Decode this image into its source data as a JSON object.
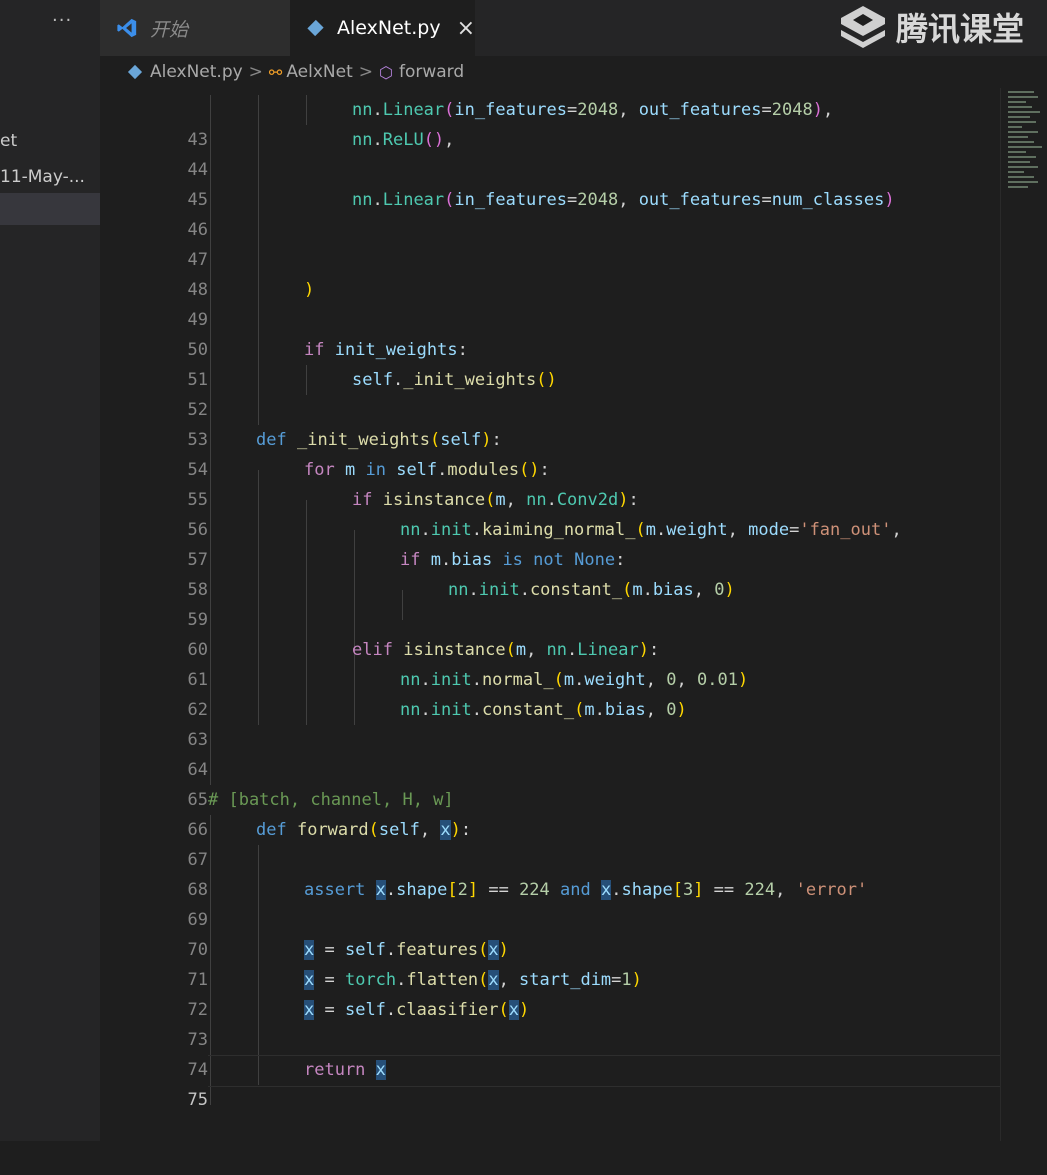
{
  "sidebar": {
    "more_label": "···",
    "items": [
      "et",
      "11-May-..."
    ]
  },
  "tabs": [
    {
      "label": "开始",
      "active": false
    },
    {
      "label": "AlexNet.py",
      "active": true,
      "close": "×"
    }
  ],
  "watermark": {
    "text": "腾讯课堂"
  },
  "breadcrumb": {
    "file": "AlexNet.py",
    "class": "AelxNet",
    "method": "forward",
    "separator": ">"
  },
  "colors": {
    "editor_bg": "#1e1e1e",
    "keyword": "#569cd6",
    "control": "#c586c0",
    "function": "#dcdcaa",
    "class": "#4ec9b0",
    "variable": "#9cdcfe",
    "number": "#b5cea8",
    "string": "#ce9178",
    "comment": "#6a9955"
  },
  "editor": {
    "active_line": 75,
    "lines": [
      {
        "n": "43"
      },
      {
        "n": "44"
      },
      {
        "n": "45"
      },
      {
        "n": "46"
      },
      {
        "n": "47"
      },
      {
        "n": "48"
      },
      {
        "n": "49"
      },
      {
        "n": "50"
      },
      {
        "n": "51"
      },
      {
        "n": "52"
      },
      {
        "n": "53"
      },
      {
        "n": "54"
      },
      {
        "n": "55"
      },
      {
        "n": "56"
      },
      {
        "n": "57"
      },
      {
        "n": "58"
      },
      {
        "n": "59"
      },
      {
        "n": "60"
      },
      {
        "n": "61"
      },
      {
        "n": "62"
      },
      {
        "n": "63"
      },
      {
        "n": "64"
      },
      {
        "n": "65"
      },
      {
        "n": "66"
      },
      {
        "n": "67"
      },
      {
        "n": "68"
      },
      {
        "n": "69"
      },
      {
        "n": "70"
      },
      {
        "n": "71"
      },
      {
        "n": "72"
      },
      {
        "n": "73"
      },
      {
        "n": "74"
      },
      {
        "n": "75"
      }
    ],
    "tokens": {
      "nn": "nn",
      "Linear": "Linear",
      "ReLU": "ReLU",
      "in_features": "in_features",
      "out_features": "out_features",
      "v2048": "2048",
      "num_classes": "num_classes",
      "if_kw": "if",
      "init_weights": "init_weights",
      "self": "self",
      "_init_weights": "_init_weights",
      "def_kw": "def",
      "for_kw": "for",
      "m": "m",
      "in_kw": "in",
      "modules": "modules",
      "isinstance": "isinstance",
      "Conv2d": "Conv2d",
      "init": "init",
      "kaiming_normal_": "kaiming_normal_",
      "weight": "weight",
      "mode": "mode",
      "fan_out": "'fan_out'",
      "bias": "bias",
      "is_kw": "is",
      "not_kw": "not",
      "None_kw": "None",
      "constant_": "constant_",
      "v0": "0",
      "elif_kw": "elif",
      "normal_": "normal_",
      "v001": "0.01",
      "comment66": "# [batch, channel, H, w]",
      "forward": "forward",
      "x": "x",
      "assert_kw": "assert",
      "shape": "shape",
      "v2": "2",
      "v3": "3",
      "v224": "224",
      "and_kw": "and",
      "error": "'error'",
      "features": "features",
      "torch": "torch",
      "flatten": "flatten",
      "start_dim": "start_dim",
      "v1": "1",
      "claasifier": "claasifier",
      "return_kw": "return"
    }
  }
}
